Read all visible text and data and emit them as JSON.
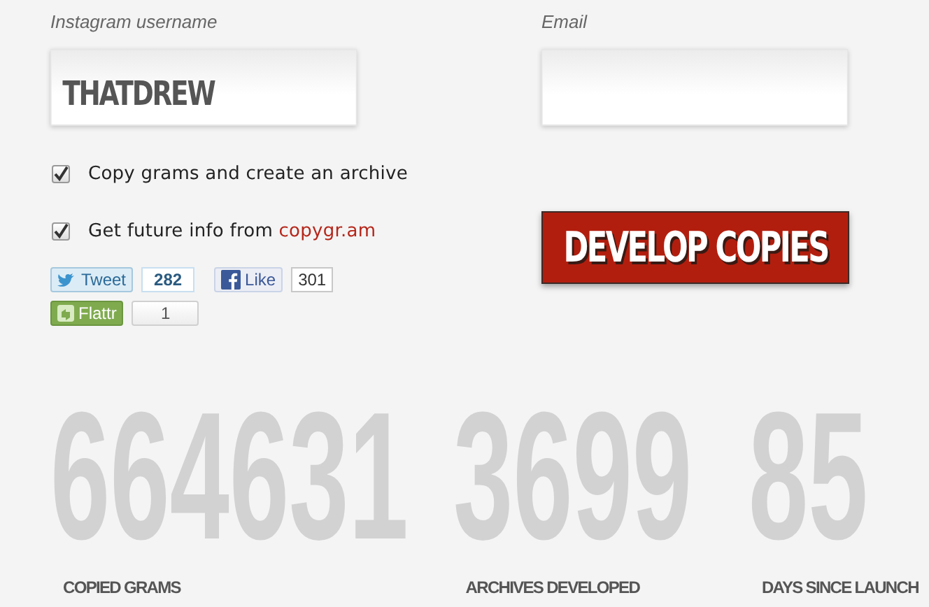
{
  "fields": [
    {
      "label": "Instagram username",
      "value": "THATDREW"
    },
    {
      "label": "Email"
    }
  ],
  "options": [
    {
      "text": "Copy grams and create an archive",
      "checked": true
    },
    {
      "text": "Get future info from ",
      "link": "copygr.am",
      "checked": true
    }
  ],
  "submit": "DEVELOP COPIES",
  "social": [
    {
      "kind": "tweet",
      "label": "Tweet",
      "count": "282"
    },
    {
      "kind": "like",
      "label": "Like",
      "count": "301"
    },
    {
      "kind": "flattr",
      "label": "Flattr",
      "count": "1"
    }
  ],
  "stats": [
    {
      "value": "664631",
      "label": "COPIED GRAMS"
    },
    {
      "value": "3699",
      "label": "ARCHIVES DEVELOPED"
    },
    {
      "value": "85",
      "label": "DAYS SINCE LAUNCH"
    }
  ]
}
